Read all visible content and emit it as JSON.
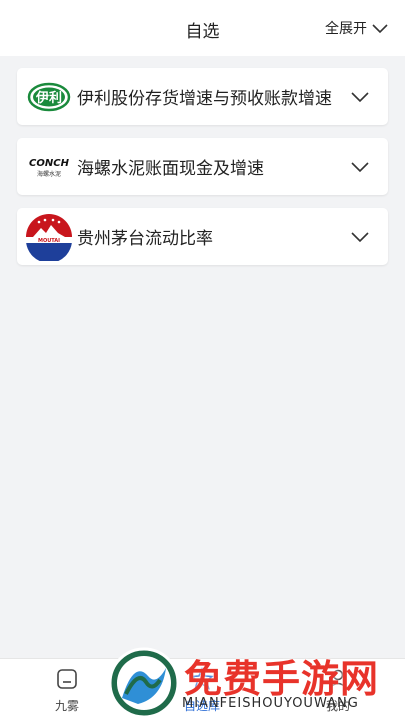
{
  "header": {
    "title": "自选",
    "expand_label": "全展开"
  },
  "watchlist": [
    {
      "name": "伊利股份存货增速与预收账款增速",
      "logo": "yili-logo",
      "logo_text": "伊利"
    },
    {
      "name": "海螺水泥账面现金及增速",
      "logo": "conch-logo",
      "logo_text": "CONCH",
      "logo_subtext": "海螺水泥"
    },
    {
      "name": "贵州茅台流动比率",
      "logo": "moutai-logo",
      "logo_text": "MOUTAI"
    }
  ],
  "tabbar": {
    "tabs": [
      {
        "label": "九雾",
        "icon": "home-icon"
      },
      {
        "label": "自选库",
        "icon": "star-icon",
        "active": true
      },
      {
        "label": "我的",
        "icon": "user-icon"
      }
    ]
  },
  "watermark": {
    "text": "免费手游网",
    "subtext": "MIANFEISHOUYOUWANG",
    "colors": {
      "text": "#e8332a",
      "logo_dark": "#1f6b4a",
      "logo_light": "#2f8fd6"
    }
  }
}
